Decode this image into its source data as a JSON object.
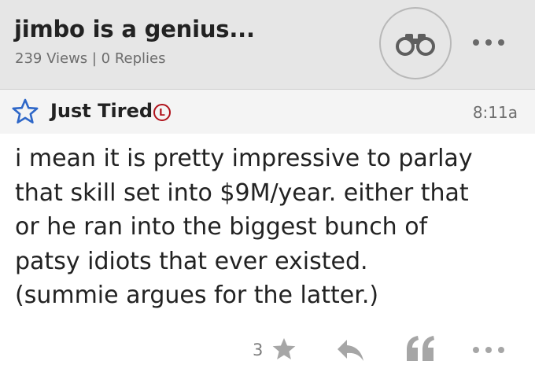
{
  "thread": {
    "title": "jimbo is a genius...",
    "meta": "239 Views | 0 Replies",
    "watch_icon": "binoculars-icon",
    "more_icon": "more-dots-icon"
  },
  "post": {
    "favorite_icon": "star-outline-icon",
    "author": "Just Tired",
    "badge": "L",
    "badge_color": "#b0121b",
    "time": "8:11a",
    "lines": [
      "i mean it is pretty impressive to parlay",
      "that skill set into $9M/year. either that",
      "or he ran into the biggest bunch of",
      "patsy idiots that ever existed.",
      "(summie argues for the latter.)"
    ]
  },
  "footer": {
    "like_count": "3",
    "like_icon": "star-filled-icon",
    "reply_icon": "reply-arrow-icon",
    "quote_icon": "quote-icon",
    "more_icon": "more-dots-icon"
  },
  "colors": {
    "header_bg": "#e6e6e6",
    "post_header_bg": "#f4f4f4",
    "star_blue": "#2e67c8",
    "footer_gray": "#a6a6a6"
  }
}
